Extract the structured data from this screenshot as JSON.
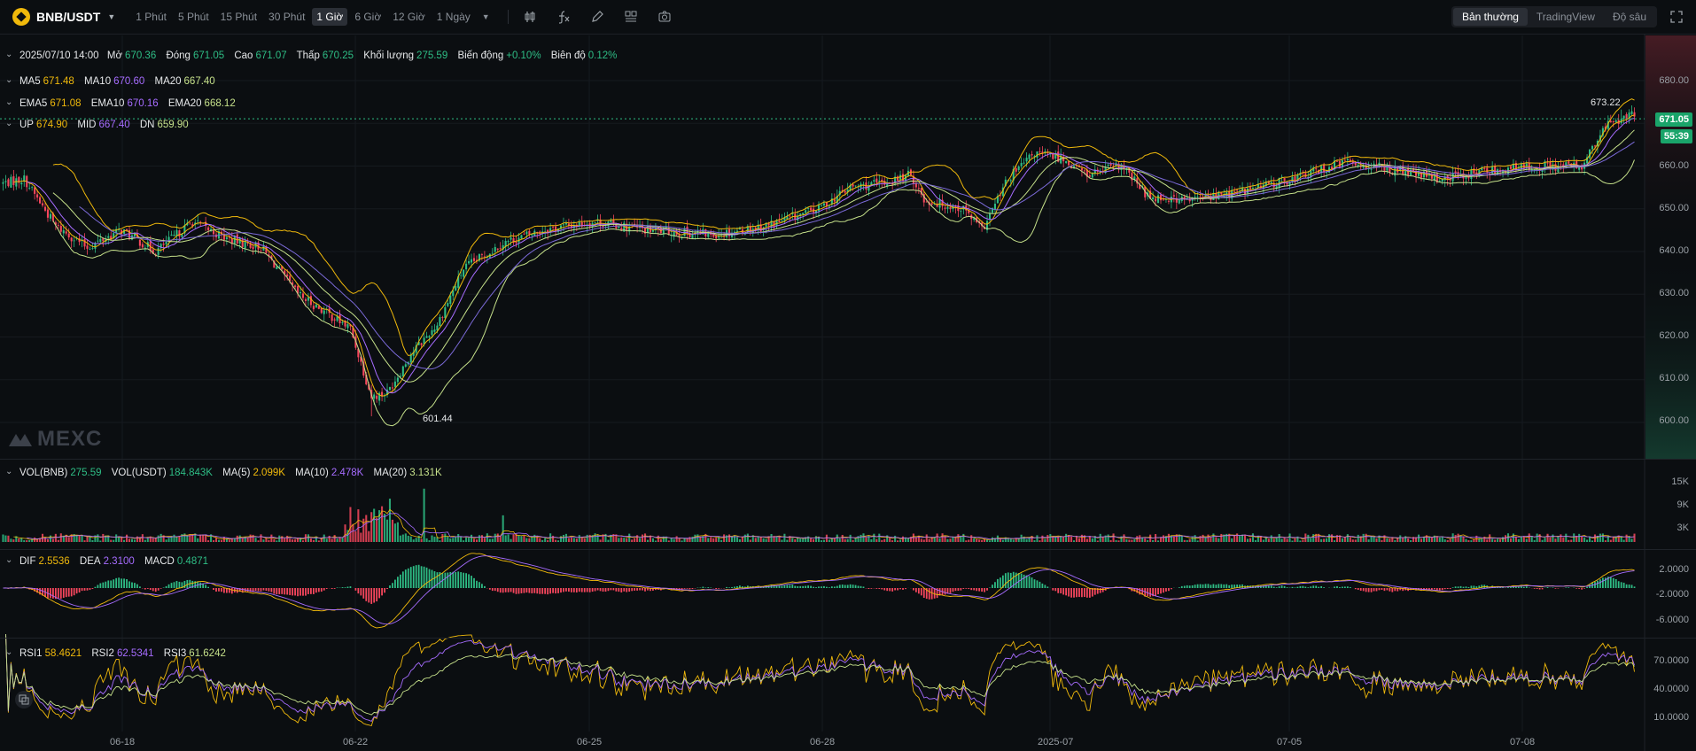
{
  "symbol": {
    "name": "BNB/USDT"
  },
  "intervals": [
    {
      "label": "1 Phút"
    },
    {
      "label": "5 Phút"
    },
    {
      "label": "15 Phút"
    },
    {
      "label": "30 Phút"
    },
    {
      "label": "1 Giờ"
    },
    {
      "label": "6 Giờ"
    },
    {
      "label": "12 Giờ"
    },
    {
      "label": "1 Ngày"
    }
  ],
  "active_interval": "1 Giờ",
  "view_tabs": [
    {
      "label": "Bản thường"
    },
    {
      "label": "TradingView"
    },
    {
      "label": "Độ sâu"
    }
  ],
  "active_view": "Bản thường",
  "ohlc": {
    "date": "2025/07/10 14:00",
    "open_label": "Mở",
    "open": "670.36",
    "close_label": "Đóng",
    "close": "671.05",
    "high_label": "Cao",
    "high": "671.07",
    "low_label": "Thấp",
    "low": "670.25",
    "volume_label": "Khối lượng",
    "volume": "275.59",
    "change_label": "Biến động",
    "change": "+0.10%",
    "amplitude_label": "Biên độ",
    "amplitude": "0.12%"
  },
  "ma": {
    "ma5_label": "MA5",
    "ma5": "671.48",
    "ma10_label": "MA10",
    "ma10": "670.60",
    "ma20_label": "MA20",
    "ma20": "667.40"
  },
  "ema": {
    "ema5_label": "EMA5",
    "ema5": "671.08",
    "ema10_label": "EMA10",
    "ema10": "670.16",
    "ema20_label": "EMA20",
    "ema20": "668.12"
  },
  "boll": {
    "up_label": "UP",
    "up": "674.90",
    "mid_label": "MID",
    "mid": "667.40",
    "dn_label": "DN",
    "dn": "659.90"
  },
  "volume_panel": {
    "vol_bnb_label": "VOL(BNB)",
    "vol_bnb": "275.59",
    "vol_usdt_label": "VOL(USDT)",
    "vol_usdt": "184.843K",
    "ma5_label": "MA(5)",
    "ma5": "2.099K",
    "ma10_label": "MA(10)",
    "ma10": "2.478K",
    "ma20_label": "MA(20)",
    "ma20": "3.131K",
    "ticks": [
      "15K",
      "9K",
      "3K"
    ]
  },
  "macd_panel": {
    "dif_label": "DIF",
    "dif": "2.5536",
    "dea_label": "DEA",
    "dea": "2.3100",
    "macd_label": "MACD",
    "macd": "0.4871",
    "ticks": [
      "2.0000",
      "-2.0000",
      "-6.0000"
    ]
  },
  "rsi_panel": {
    "rsi1_label": "RSI1",
    "rsi1": "58.4621",
    "rsi2_label": "RSI2",
    "rsi2": "62.5341",
    "rsi3_label": "RSI3",
    "rsi3": "61.6242",
    "ticks": [
      "70.0000",
      "40.0000",
      "10.0000"
    ]
  },
  "price_axis": [
    "680.00",
    "670.00",
    "660.00",
    "650.00",
    "640.00",
    "630.00",
    "620.00",
    "610.00",
    "600.00"
  ],
  "last_price": "671.05",
  "countdown": "55:39",
  "high_marker": "673.22",
  "low_marker": "601.44",
  "watermark": "MEXC",
  "x_axis": [
    "06-18",
    "06-22",
    "06-25",
    "06-28",
    "2025-07",
    "07-05",
    "07-08"
  ],
  "colors": {
    "up": "#2ebd85",
    "down": "#f6465d",
    "ma5": "#f0b90b",
    "ma10": "#a66cff",
    "ma20": "#c5e08a",
    "background": "#0b0e11"
  },
  "chart_data": {
    "type": "candlestick",
    "title": "BNB/USDT 1 Giờ",
    "ylim": [
      597,
      686
    ],
    "close_anchors": [
      [
        0,
        656
      ],
      [
        8,
        657
      ],
      [
        20,
        646
      ],
      [
        32,
        641
      ],
      [
        45,
        645
      ],
      [
        58,
        640
      ],
      [
        72,
        647
      ],
      [
        85,
        643
      ],
      [
        98,
        641
      ],
      [
        112,
        630
      ],
      [
        122,
        626
      ],
      [
        132,
        622
      ],
      [
        140,
        606
      ],
      [
        146,
        607
      ],
      [
        155,
        616
      ],
      [
        165,
        623
      ],
      [
        175,
        636
      ],
      [
        190,
        642
      ],
      [
        205,
        645
      ],
      [
        225,
        647
      ],
      [
        245,
        645
      ],
      [
        270,
        644
      ],
      [
        290,
        646
      ],
      [
        310,
        650
      ],
      [
        322,
        655
      ],
      [
        335,
        656
      ],
      [
        345,
        658
      ],
      [
        350,
        652
      ],
      [
        365,
        650
      ],
      [
        372,
        645
      ],
      [
        382,
        657
      ],
      [
        392,
        663
      ],
      [
        402,
        662
      ],
      [
        412,
        658
      ],
      [
        425,
        660
      ],
      [
        435,
        653
      ],
      [
        450,
        652
      ],
      [
        470,
        654
      ],
      [
        490,
        657
      ],
      [
        510,
        661
      ],
      [
        530,
        659
      ],
      [
        545,
        657
      ],
      [
        565,
        659
      ],
      [
        585,
        660
      ],
      [
        600,
        660
      ],
      [
        610,
        670
      ],
      [
        620,
        672
      ]
    ],
    "high": 673.22,
    "low": 601.44
  }
}
